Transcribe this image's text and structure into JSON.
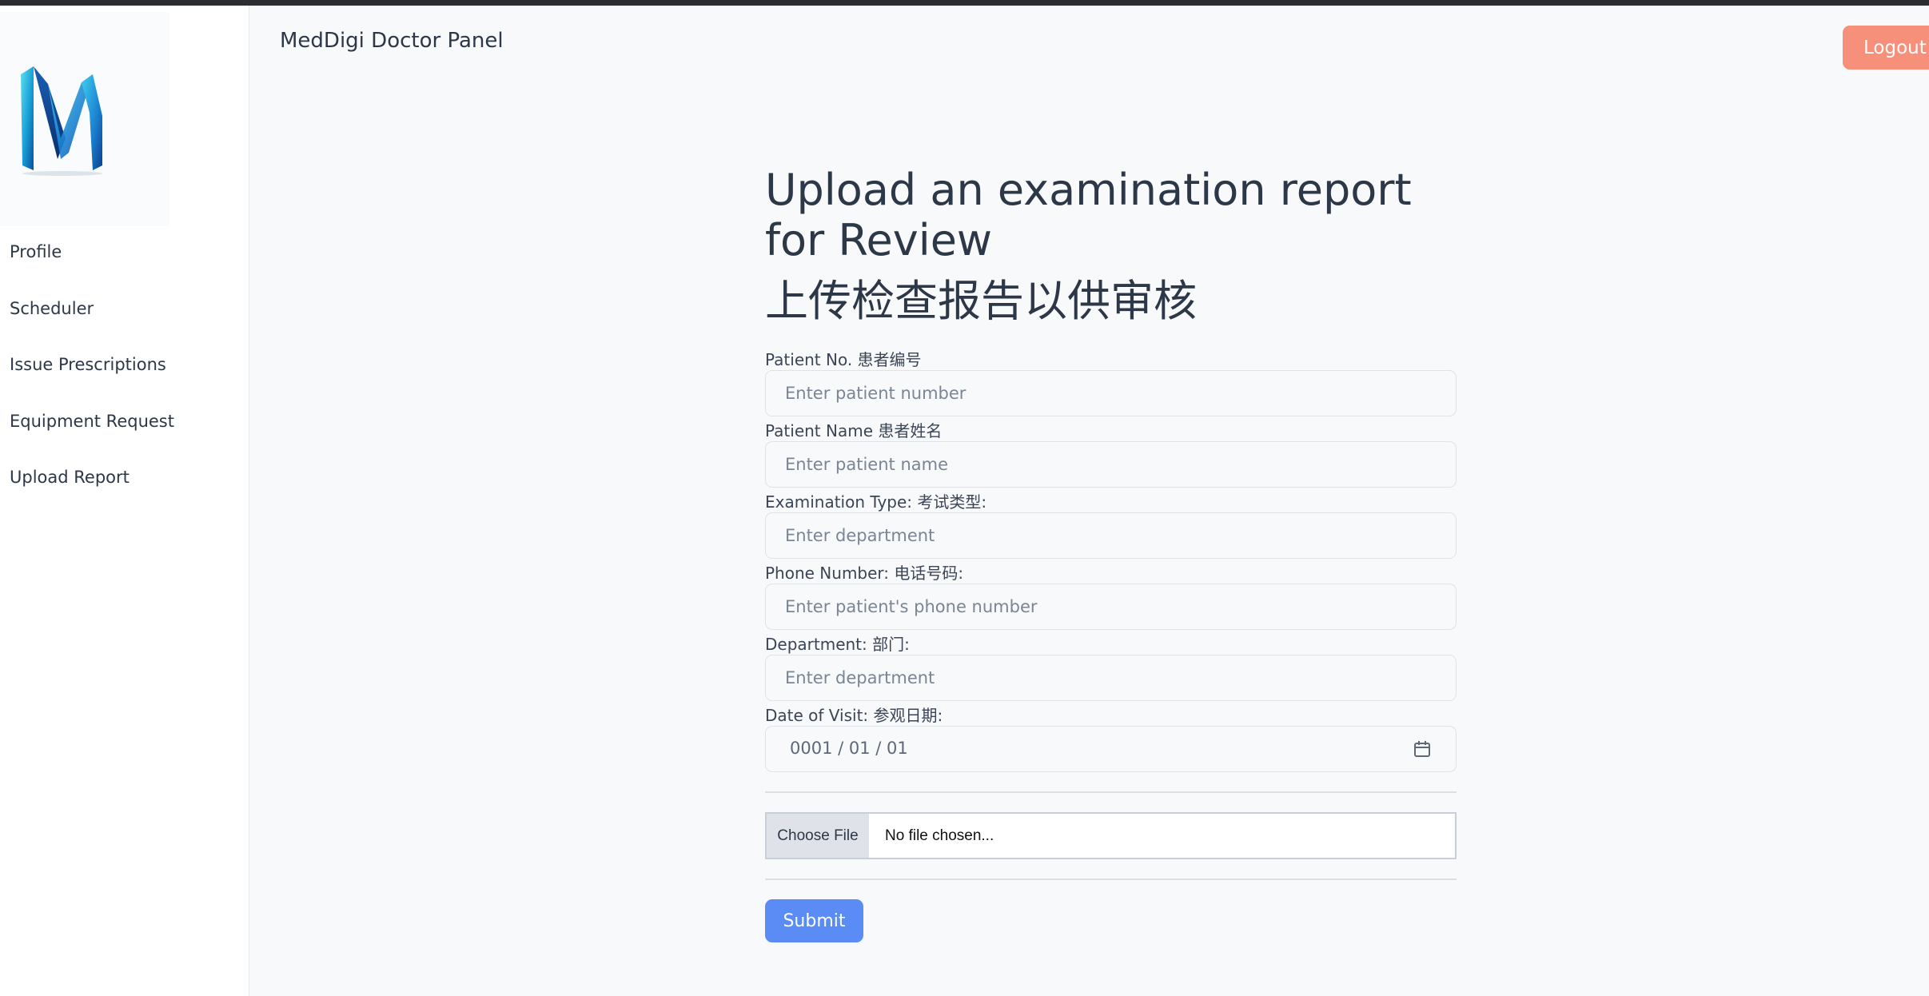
{
  "header": {
    "brand": "MedDigi Doctor Panel",
    "logout_label": "Logout"
  },
  "sidebar": {
    "logo_icon": "meddigi-m-logo",
    "items": [
      {
        "label": "Profile"
      },
      {
        "label": "Scheduler"
      },
      {
        "label": "Issue Prescriptions"
      },
      {
        "label": "Equipment Request"
      },
      {
        "label": "Upload Report"
      }
    ]
  },
  "main": {
    "title_en": "Upload an examination report for Review",
    "title_cn": "上传检查报告以供审核",
    "fields": [
      {
        "label": "Patient No. 患者编号",
        "placeholder": "Enter patient number",
        "value": ""
      },
      {
        "label": "Patient Name 患者姓名",
        "placeholder": "Enter patient name",
        "value": ""
      },
      {
        "label": "Examination Type: 考试类型:",
        "placeholder": "Enter department",
        "value": ""
      },
      {
        "label": "Phone Number: 电话号码:",
        "placeholder": "Enter patient's phone number",
        "value": ""
      },
      {
        "label": "Department: 部门:",
        "placeholder": "Enter department",
        "value": ""
      }
    ],
    "date_field": {
      "label": "Date of Visit: 参观日期:",
      "value": "0001 / 01 / 01",
      "icon": "calendar-icon"
    },
    "file_upload": {
      "button_label": "Choose File",
      "status": "No file chosen..."
    },
    "submit_label": "Submit"
  },
  "colors": {
    "accent_submit": "#5b8cf5",
    "logout": "#f7907a",
    "text": "#2c3748",
    "background": "#f8f9fa"
  }
}
